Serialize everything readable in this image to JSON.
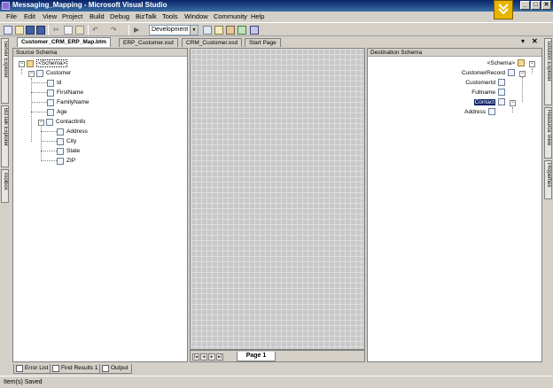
{
  "window": {
    "title": "Messaging_Mapping - Microsoft Visual Studio",
    "minimize": "_",
    "maximize": "□",
    "close": "✕"
  },
  "menu": [
    "File",
    "Edit",
    "View",
    "Project",
    "Build",
    "Debug",
    "BizTalk",
    "Tools",
    "Window",
    "Community",
    "Help"
  ],
  "toolbar": {
    "configuration": "Development",
    "icons": [
      "new-project-icon",
      "add-item-icon",
      "save-icon",
      "save-all-icon",
      "cut-icon",
      "copy-icon",
      "paste-icon",
      "undo-icon",
      "redo-icon",
      "start-debug-icon",
      "find-icon",
      "properties-icon",
      "toolbox-icon",
      "object-browser-icon",
      "window-icon"
    ]
  },
  "left_strip": [
    "Server Explorer",
    "BizTalk Explorer",
    "Toolbox"
  ],
  "right_strip": [
    "Solution Explorer",
    "Resource View",
    "Properties"
  ],
  "doc_tabs": [
    "Customer_CRM_ERP_Map.btm",
    "ERP_Customer.xsd",
    "CRM_Customer.xsd",
    "Start Page"
  ],
  "doc_controls": {
    "dropdown": "▾",
    "close": "✕"
  },
  "source_schema": {
    "header": "Source Schema",
    "root": "<Schema>",
    "record": "Customer",
    "fields": [
      "Id",
      "FirstName",
      "FamilyName",
      "Age"
    ],
    "subrecord": "ContactInfo",
    "subfields": [
      "Address",
      "City",
      "State",
      "ZIP"
    ]
  },
  "destination_schema": {
    "header": "Destination Schema",
    "root": "<Schema>",
    "record": "CustomerRecord",
    "fields": [
      "CustomerId",
      "Fullname"
    ],
    "subrecord": "Contact",
    "subfields": [
      "Address"
    ]
  },
  "grid": {
    "page_tab": "Page 1",
    "nav": [
      "|◂",
      "◂",
      "▸",
      "▸|"
    ]
  },
  "bottom_tabs": [
    "Error List",
    "Find Results 1",
    "Output"
  ],
  "status": "Item(s) Saved"
}
